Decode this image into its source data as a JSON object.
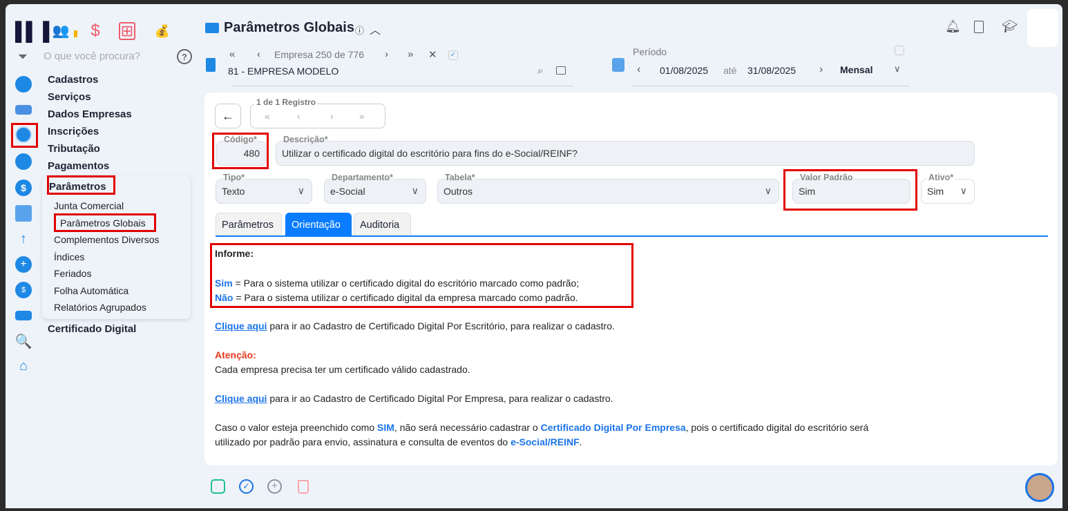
{
  "header": {
    "title": "Parâmetros Globais"
  },
  "search": {
    "placeholder": "O que você procura?"
  },
  "company": {
    "nav": "Empresa 250 de 776",
    "name": "81 - EMPRESA MODELO"
  },
  "period": {
    "label": "Período",
    "from": "01/08/2025",
    "sep": "até",
    "to": "31/08/2025",
    "mode": "Mensal"
  },
  "menu": {
    "items": [
      "Cadastros",
      "Serviços",
      "Dados Empresas",
      "Inscrições",
      "Tributação",
      "Pagamentos",
      "Parâmetros",
      "Certificado Digital"
    ],
    "sub": [
      "Junta Comercial",
      "Parâmetros Globais",
      "Complementos Diversos",
      "Índices",
      "Feriados",
      "Folha Automática",
      "Relatórios Agrupados"
    ]
  },
  "record": {
    "label": "1 de 1 Registro"
  },
  "form": {
    "codigo_label": "Código*",
    "codigo": "480",
    "descricao_label": "Descrição*",
    "descricao": "Utilizar o certificado digital do escritório para fins do e-Social/REINF?",
    "tipo_label": "Tipo*",
    "tipo": "Texto",
    "dep_label": "Departamento*",
    "dep": "e-Social",
    "tabela_label": "Tabela*",
    "tabela": "Outros",
    "valor_label": "Valor Padrão",
    "valor": "Sim",
    "ativo_label": "Ativo*",
    "ativo": "Sim"
  },
  "tabs": [
    "Parâmetros",
    "Orientação",
    "Auditoria"
  ],
  "content": {
    "informe": "Informe:",
    "sim": "Sim",
    "sim_text": " = Para o sistema utilizar o certificado digital do escritório marcado como padrão;",
    "nao": "Não",
    "nao_text": " = Para o sistema utilizar o certificado digital da empresa marcado como padrão.",
    "link1": "Clique aqui",
    "link1_text": " para ir ao Cadastro de Certificado Digital Por Escritório, para realizar o cadastro.",
    "atencao": "Atenção:",
    "atencao_text": "Cada empresa precisa ter um certificado válido cadastrado.",
    "link2": "Clique aqui",
    "link2_text": " para ir ao Cadastro de Certificado Digital Por Empresa, para realizar o cadastro.",
    "p1": "Caso o valor esteja preenchido como ",
    "p1b": "SIM",
    "p2": ", não será necessário cadastrar o ",
    "p2b": "Certificado Digital Por Empresa",
    "p3": ", pois o certificado digital do escritório será",
    "p4": "utilizado por padrão para envio, assinatura e consulta de eventos do ",
    "p4b": "e-Social/REINF",
    "p5": "."
  },
  "colors": {
    "accent": "#0a7cff",
    "highlight": "#e10000",
    "atencao": "#e53a1e"
  }
}
